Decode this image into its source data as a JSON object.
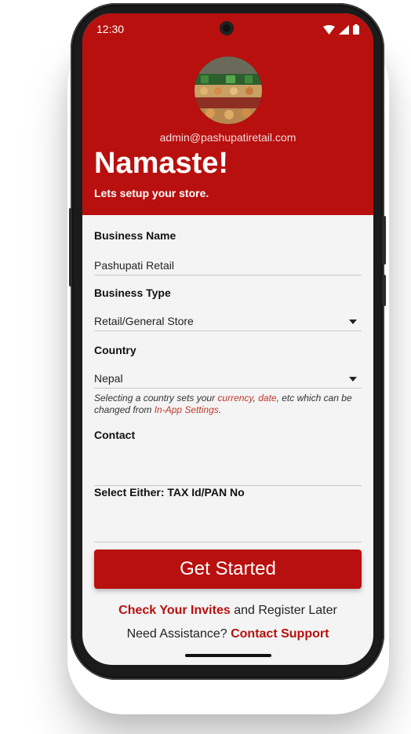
{
  "status": {
    "time": "12:30"
  },
  "header": {
    "email": "admin@pashupatiretail.com",
    "greeting": "Namaste!",
    "subtitle": "Lets setup your store."
  },
  "form": {
    "business_name": {
      "label": "Business Name",
      "value": "Pashupati Retail"
    },
    "business_type": {
      "label": "Business Type",
      "value": "Retail/General Store"
    },
    "country": {
      "label": "Country",
      "value": "Nepal",
      "hint_prefix": "Selecting a country sets your ",
      "hint_currency": "currency",
      "hint_sep": ", ",
      "hint_date": "date",
      "hint_mid": ", etc which can be changed from ",
      "hint_settings": "In-App Settings",
      "hint_end": "."
    },
    "contact": {
      "label": "Contact",
      "value": ""
    },
    "tax": {
      "label": "Select Either: TAX Id/PAN No",
      "value": ""
    }
  },
  "actions": {
    "get_started": "Get Started",
    "invites_link": "Check Your Invites",
    "invites_rest": " and Register Later",
    "assist_prefix": "Need Assistance? ",
    "support_link": "Contact Support"
  },
  "colors": {
    "brand": "#b8100e",
    "accent": "#c0392b"
  }
}
